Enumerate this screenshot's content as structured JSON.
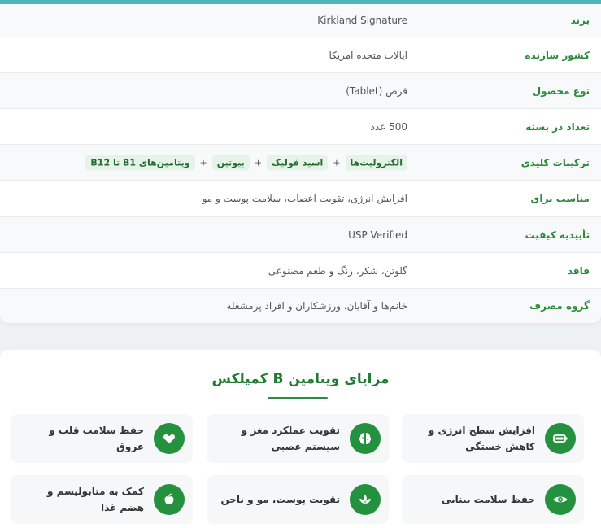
{
  "specs": [
    {
      "label": "برند",
      "value": "Kirkland Signature"
    },
    {
      "label": "کشور سازنده",
      "value": "ایالات متحده آمریکا"
    },
    {
      "label": "نوع محصول",
      "value": "قرص (Tablet)"
    },
    {
      "label": "تعداد در بسته",
      "value": "500 عدد"
    },
    {
      "label": "ترکیبات کلیدی",
      "chips": [
        "ویتامین‌های B1 تا B12",
        "بیوتین",
        "اسید فولیک",
        "الکترولیت‌ها"
      ],
      "separator": "+"
    },
    {
      "label": "مناسب برای",
      "value": "افزایش انرژی، تقویت اعصاب، سلامت پوست و مو"
    },
    {
      "label": "تأییدیه کیفیت",
      "value": "USP Verified"
    },
    {
      "label": "فاقد",
      "value": "گلوتن، شکر، رنگ و طعم مصنوعی"
    },
    {
      "label": "گروه مصرف",
      "value": "خانم‌ها و آقایان، ورزشکاران و افراد پرمشغله"
    }
  ],
  "benefits": {
    "title": "مزایای ویتامین B کمپلکس",
    "items": [
      {
        "icon": "battery-icon",
        "text": "افزایش سطح انرژی و کاهش خستگی"
      },
      {
        "icon": "brain-icon",
        "text": "تقویت عملکرد مغز و سیستم عصبی"
      },
      {
        "icon": "heart-icon",
        "text": "حفظ سلامت قلب و عروق"
      },
      {
        "icon": "eye-icon",
        "text": "حفظ سلامت بینایی"
      },
      {
        "icon": "spa-icon",
        "text": "تقویت پوست، مو و ناخن"
      },
      {
        "icon": "apple-icon",
        "text": "کمک به متابولیسم و هضم غذا"
      }
    ]
  },
  "colors": {
    "accent": "#23913e",
    "label": "#2a8a3a",
    "topbar": "#4fb6b8"
  }
}
